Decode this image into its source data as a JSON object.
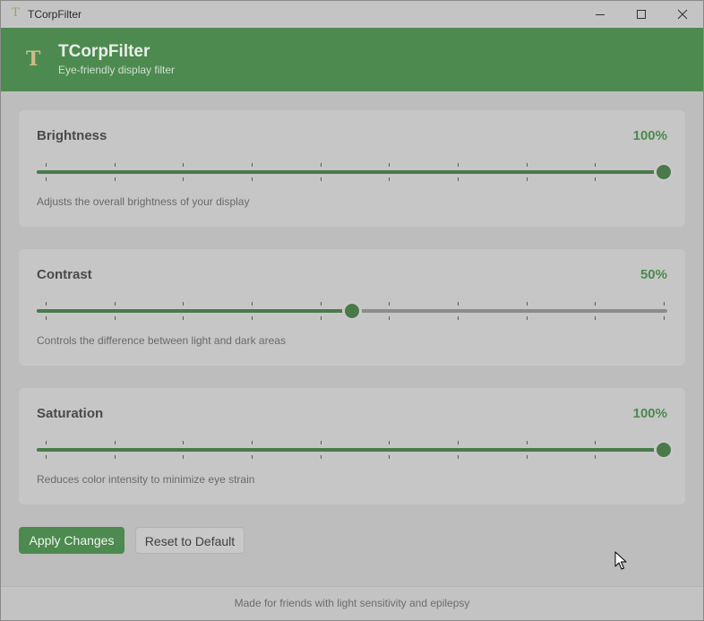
{
  "window": {
    "title": "TCorpFilter",
    "icon": "T"
  },
  "header": {
    "logo": "T",
    "app_name": "TCorpFilter",
    "subtitle": "Eye-friendly display filter",
    "color": "#4d8a4f"
  },
  "controls": [
    {
      "label": "Brightness",
      "value_text": "100%",
      "value": 100,
      "description": "Adjusts the overall brightness of your display"
    },
    {
      "label": "Contrast",
      "value_text": "50%",
      "value": 50,
      "description": "Controls the difference between light and dark areas"
    },
    {
      "label": "Saturation",
      "value_text": "100%",
      "value": 100,
      "description": "Reduces color intensity to minimize eye strain"
    }
  ],
  "actions": {
    "apply_label": "Apply Changes",
    "reset_label": "Reset to Default"
  },
  "footer": {
    "note": "Made for friends with light sensitivity and epilepsy"
  },
  "colors": {
    "accent": "#4d8a4f",
    "slider_fill": "#4a7a4a",
    "value_text": "#4b8a4d"
  },
  "icons": {
    "minimize": "minimize-icon",
    "maximize": "maximize-icon",
    "close": "close-icon",
    "cursor": "mouse-cursor-icon"
  }
}
